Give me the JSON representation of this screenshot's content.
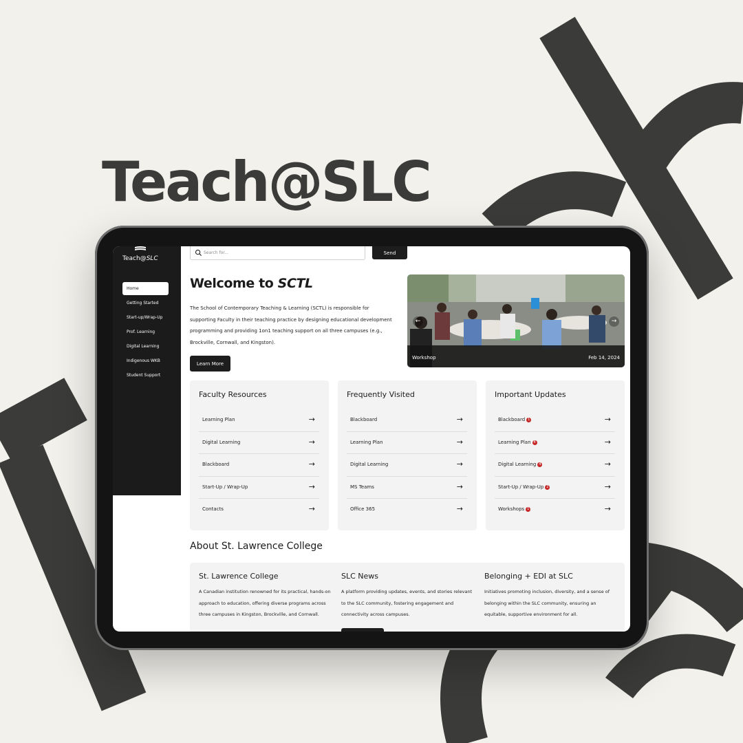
{
  "hero": {
    "title": "Teach@SLC"
  },
  "sidebar": {
    "logo_text": "Teach@",
    "logo_italic": "SLC",
    "items": [
      {
        "label": "Home",
        "active": true
      },
      {
        "label": "Getting Started"
      },
      {
        "label": "Start-up/Wrap-Up"
      },
      {
        "label": "Prof. Learning"
      },
      {
        "label": "Digital Learning"
      },
      {
        "label": "Indigenous WKB"
      },
      {
        "label": "Student Support"
      }
    ]
  },
  "search": {
    "placeholder": "Search for...",
    "button_label": "Send"
  },
  "welcome": {
    "title_prefix": "Welcome to ",
    "title_italic": "SCTL",
    "intro": "The School of Contemporary Teaching & Learning (SCTL) is responsible for supporting Faculty in their teaching practice by designing educational development programming and providing 1on1 teaching support on all three campuses (e.g., Brockville, Cornwall, and Kingston).",
    "button_label": "Learn More"
  },
  "carousel": {
    "caption": "Workshop",
    "date": "Feb 14, 2024"
  },
  "cards": [
    {
      "title": "Faculty Resources",
      "items": [
        {
          "label": "Learning Plan"
        },
        {
          "label": "Digital Learning"
        },
        {
          "label": "Blackboard"
        },
        {
          "label": "Start-Up / Wrap-Up"
        },
        {
          "label": "Contacts"
        }
      ]
    },
    {
      "title": "Frequently Visited",
      "items": [
        {
          "label": "Blackboard"
        },
        {
          "label": "Learning Plan"
        },
        {
          "label": "Digital Learning"
        },
        {
          "label": "MS Teams"
        },
        {
          "label": "Office 365"
        }
      ]
    },
    {
      "title": "Important Updates",
      "items": [
        {
          "label": "Blackboard",
          "badge": "1"
        },
        {
          "label": "Learning Plan",
          "badge": "4"
        },
        {
          "label": "Digital Learning",
          "badge": "4"
        },
        {
          "label": "Start-Up / Wrap-Up",
          "badge": "2"
        },
        {
          "label": "Workshops",
          "badge": "1"
        }
      ]
    }
  ],
  "about": {
    "title": "About St. Lawrence College",
    "columns": [
      {
        "title": "St. Lawrence College",
        "text": "A Canadian institution renowned for its practical, hands-on approach to education, offering diverse programs across three campuses in Kingston, Brockville, and Cornwall."
      },
      {
        "title": "SLC News",
        "text": "A platform providing updates, events, and stories relevant to the SLC community, fostering engagement and connectivity across campuses."
      },
      {
        "title": "Belonging + EDI at SLC",
        "text": "Initiatives promoting inclusion, diversity, and a sense of belonging within the SLC community, ensuring an equitable, supportive environment for all."
      }
    ]
  },
  "colors": {
    "dark": "#1b1b1b",
    "background": "#f2f1ec",
    "shape": "#3b3b39",
    "badge": "#c62828"
  }
}
